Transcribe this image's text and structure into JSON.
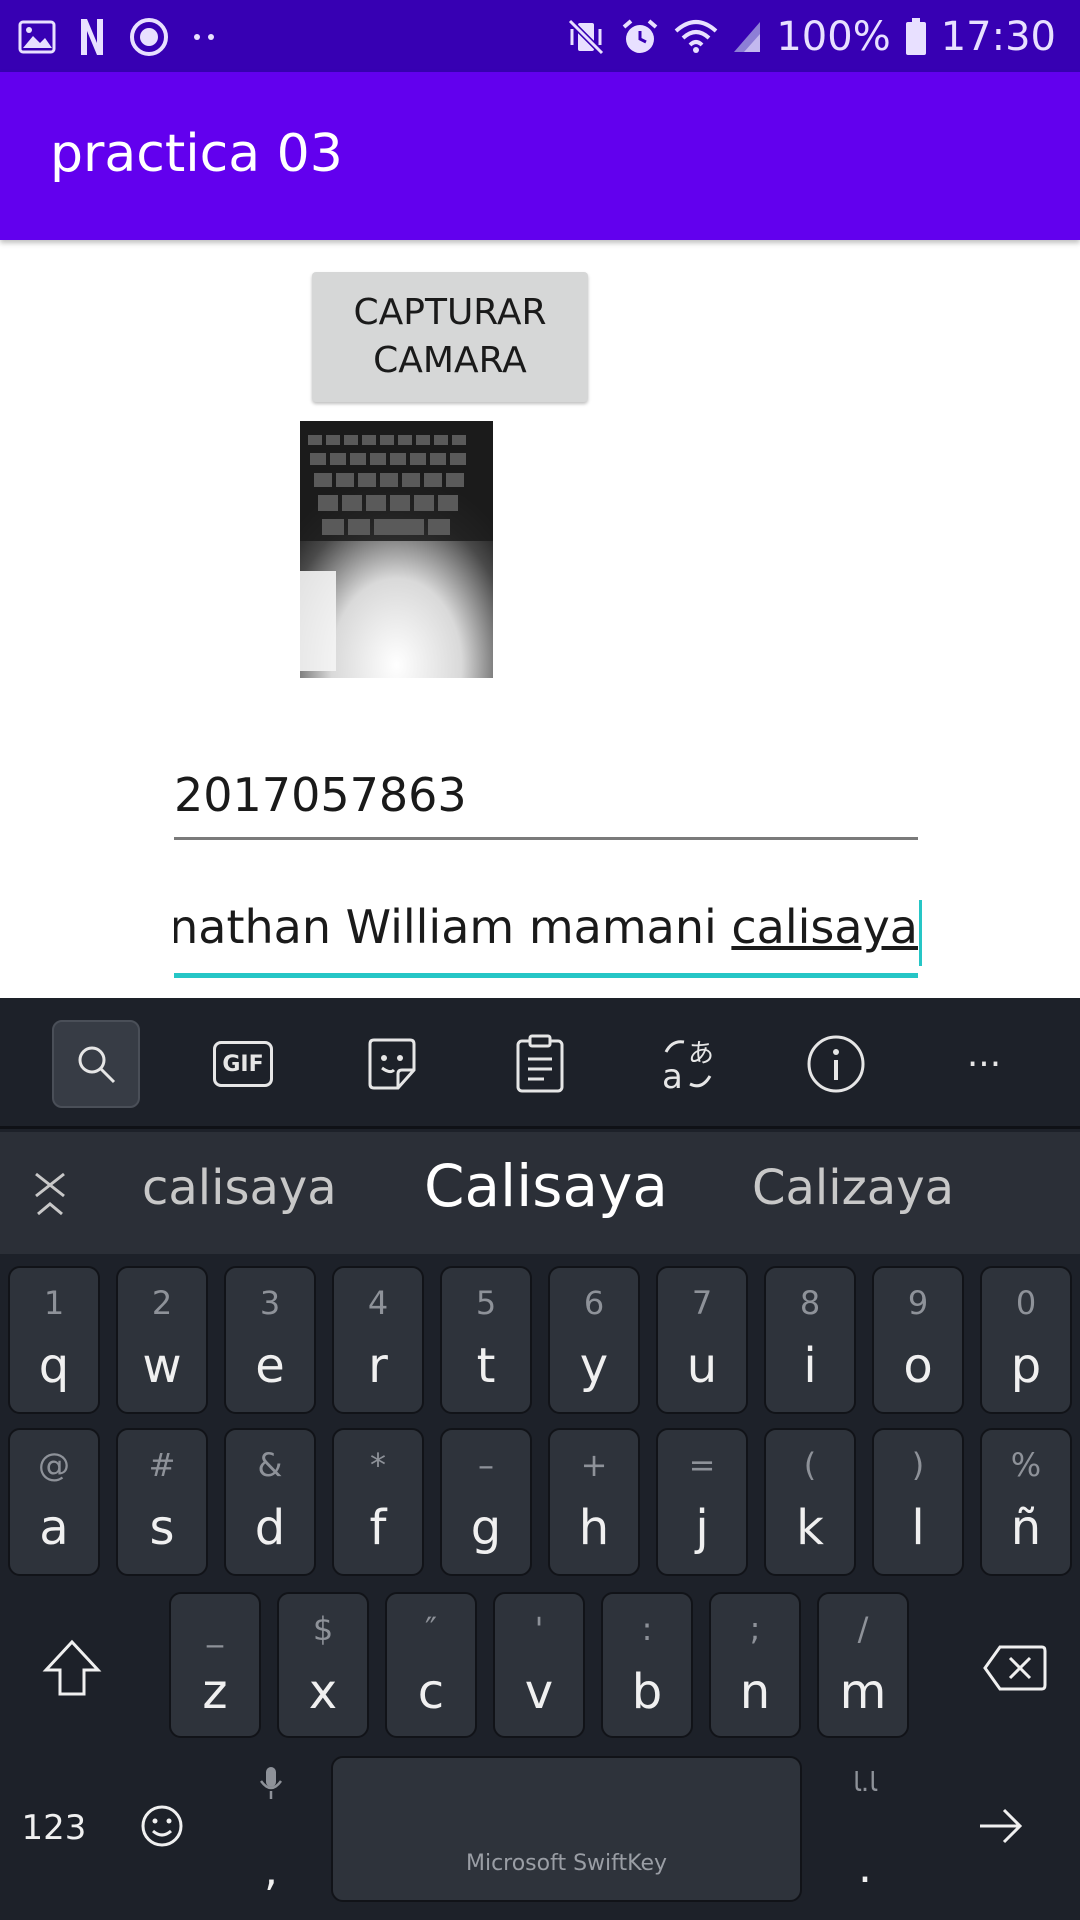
{
  "status_bar": {
    "battery_text": "100%",
    "time": "17:30",
    "left_icons": [
      "gallery-icon",
      "n-app-icon",
      "sync-icon",
      "more-dots-icon"
    ],
    "right_icons": [
      "vibrate-mute-icon",
      "alarm-icon",
      "wifi-icon",
      "signal-icon",
      "battery-icon"
    ]
  },
  "app_bar": {
    "title": "practica 03"
  },
  "content": {
    "capture_button": "CAPTURAR CAMARA",
    "id_field": "2017057863",
    "name_field_prefix": "jonathan William mamani ",
    "name_field_composing": "calisaya"
  },
  "keyboard": {
    "toolbar": [
      "search-icon",
      "gif-icon",
      "sticker-icon",
      "clipboard-icon",
      "translate-icon",
      "info-icon",
      "more-icon"
    ],
    "gif_label": "GIF",
    "more_label": "···",
    "suggestions": [
      "calisaya",
      "Calisaya",
      "Calizaya"
    ],
    "rows": [
      [
        {
          "k": "q",
          "h": "1"
        },
        {
          "k": "w",
          "h": "2"
        },
        {
          "k": "e",
          "h": "3"
        },
        {
          "k": "r",
          "h": "4"
        },
        {
          "k": "t",
          "h": "5"
        },
        {
          "k": "y",
          "h": "6"
        },
        {
          "k": "u",
          "h": "7"
        },
        {
          "k": "i",
          "h": "8"
        },
        {
          "k": "o",
          "h": "9"
        },
        {
          "k": "p",
          "h": "0"
        }
      ],
      [
        {
          "k": "a",
          "h": "@"
        },
        {
          "k": "s",
          "h": "#"
        },
        {
          "k": "d",
          "h": "&"
        },
        {
          "k": "f",
          "h": "*"
        },
        {
          "k": "g",
          "h": "–"
        },
        {
          "k": "h",
          "h": "+"
        },
        {
          "k": "j",
          "h": "="
        },
        {
          "k": "k",
          "h": "("
        },
        {
          "k": "l",
          "h": ")"
        },
        {
          "k": "ñ",
          "h": "%"
        }
      ],
      [
        {
          "k": "z",
          "h": "_"
        },
        {
          "k": "x",
          "h": "$"
        },
        {
          "k": "c",
          "h": "″"
        },
        {
          "k": "v",
          "h": "'"
        },
        {
          "k": "b",
          "h": ":"
        },
        {
          "k": "n",
          "h": ";"
        },
        {
          "k": "m",
          "h": "/"
        }
      ]
    ],
    "numbers_key": "123",
    "comma_key": ",",
    "period_key": ".",
    "period_hint": "ﺎ.ﺎ",
    "space_label": "Microsoft SwiftKey"
  }
}
